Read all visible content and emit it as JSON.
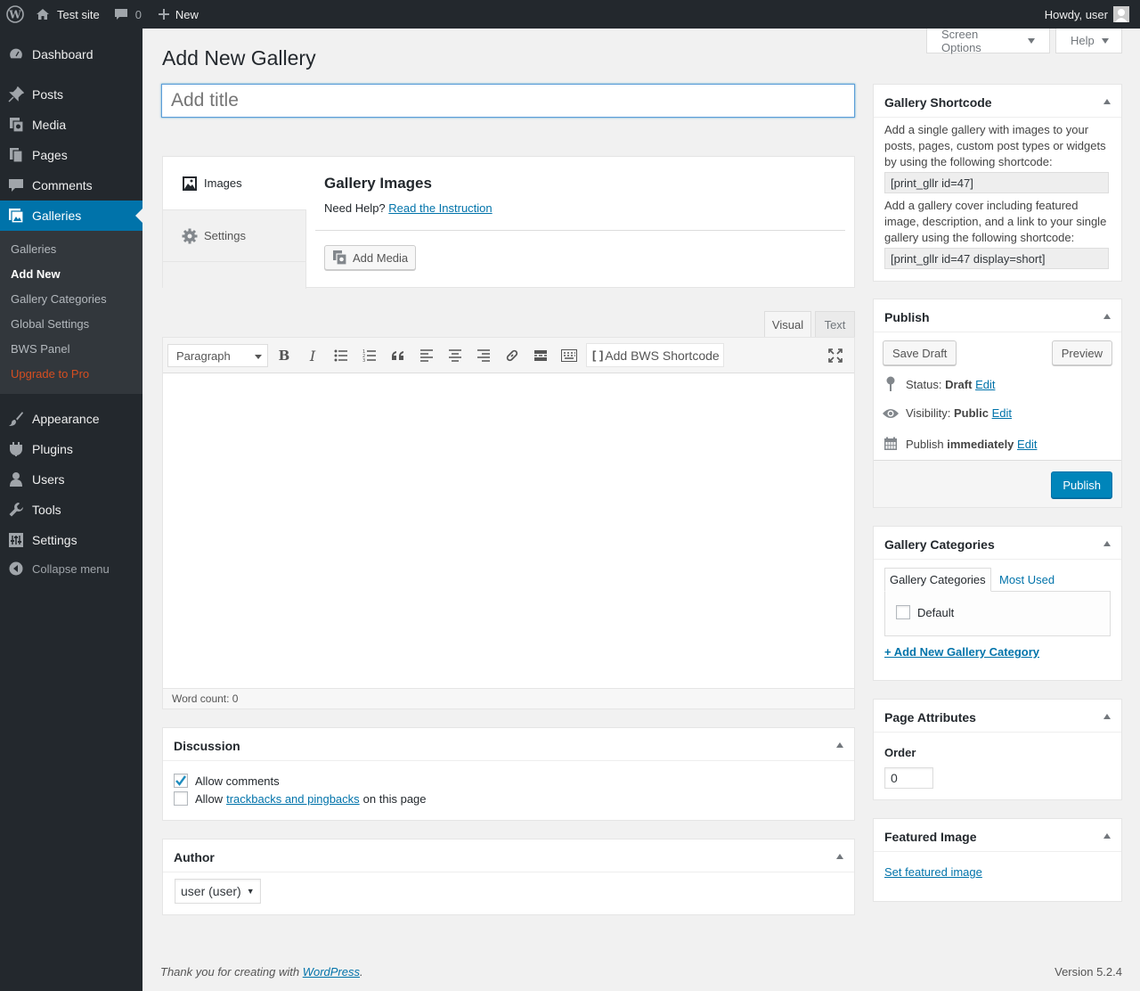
{
  "admin_bar": {
    "site_name": "Test site",
    "comments_count": "0",
    "new_label": "New",
    "howdy": "Howdy, user"
  },
  "sidebar": {
    "items": [
      {
        "label": "Dashboard",
        "icon": "dashboard-icon"
      },
      {
        "label": "Posts",
        "icon": "pin-icon"
      },
      {
        "label": "Media",
        "icon": "media-icon"
      },
      {
        "label": "Pages",
        "icon": "pages-icon"
      },
      {
        "label": "Comments",
        "icon": "comment-icon"
      },
      {
        "label": "Galleries",
        "icon": "gallery-icon"
      },
      {
        "label": "Appearance",
        "icon": "brush-icon"
      },
      {
        "label": "Plugins",
        "icon": "plug-icon"
      },
      {
        "label": "Users",
        "icon": "user-icon"
      },
      {
        "label": "Tools",
        "icon": "wrench-icon"
      },
      {
        "label": "Settings",
        "icon": "settings-icon"
      }
    ],
    "submenu": [
      "Galleries",
      "Add New",
      "Gallery Categories",
      "Global Settings",
      "BWS Panel",
      "Upgrade to Pro"
    ],
    "collapse_label": "Collapse menu"
  },
  "screen_options_label": "Screen Options",
  "help_label": "Help",
  "page_title": "Add New Gallery",
  "title_placeholder": "Add title",
  "gallery_box": {
    "tab_images": "Images",
    "tab_settings": "Settings",
    "heading": "Gallery Images",
    "need_help": "Need Help?",
    "instruction_link": "Read the Instruction",
    "add_media": "Add Media"
  },
  "editor": {
    "tab_visual": "Visual",
    "tab_text": "Text",
    "format_select": "Paragraph",
    "bws_shortcode": "Add BWS Shortcode",
    "word_count": "Word count: 0"
  },
  "discussion": {
    "title": "Discussion",
    "allow_comments": "Allow comments",
    "allow_comments_checked": true,
    "allow_prefix": "Allow",
    "trackbacks_link": "trackbacks and pingbacks",
    "on_this_page": "on this page",
    "trackbacks_checked": false
  },
  "author": {
    "title": "Author",
    "selected": "user (user)"
  },
  "shortcode_box": {
    "title": "Gallery Shortcode",
    "desc1": "Add a single gallery with images to your posts, pages, custom post types or widgets by using the following shortcode:",
    "code1": "[print_gllr id=47]",
    "desc2": "Add a gallery cover including featured image, description, and a link to your single gallery using the following shortcode:",
    "code2": "[print_gllr id=47 display=short]"
  },
  "publish_box": {
    "title": "Publish",
    "save_draft": "Save Draft",
    "preview": "Preview",
    "status_label": "Status:",
    "status_value": "Draft",
    "visibility_label": "Visibility:",
    "visibility_value": "Public",
    "publish_label": "Publish",
    "publish_value": "immediately",
    "edit": "Edit",
    "publish_button": "Publish"
  },
  "categories_box": {
    "title": "Gallery Categories",
    "tab_all": "Gallery Categories",
    "tab_most_used": "Most Used",
    "category": "Default",
    "add_new": "+ Add New Gallery Category"
  },
  "attributes_box": {
    "title": "Page Attributes",
    "order_label": "Order",
    "order_value": "0"
  },
  "featured_box": {
    "title": "Featured Image",
    "set_link": "Set featured image"
  },
  "footer": {
    "thanks_prefix": "Thank you for creating with",
    "wordpress": "WordPress",
    "thanks_suffix": ".",
    "version": "Version 5.2.4"
  },
  "colors": {
    "admin_dark": "#23282d",
    "accent": "#0073aa",
    "upgrade": "#d54e21",
    "publish_button": "#0085ba"
  }
}
